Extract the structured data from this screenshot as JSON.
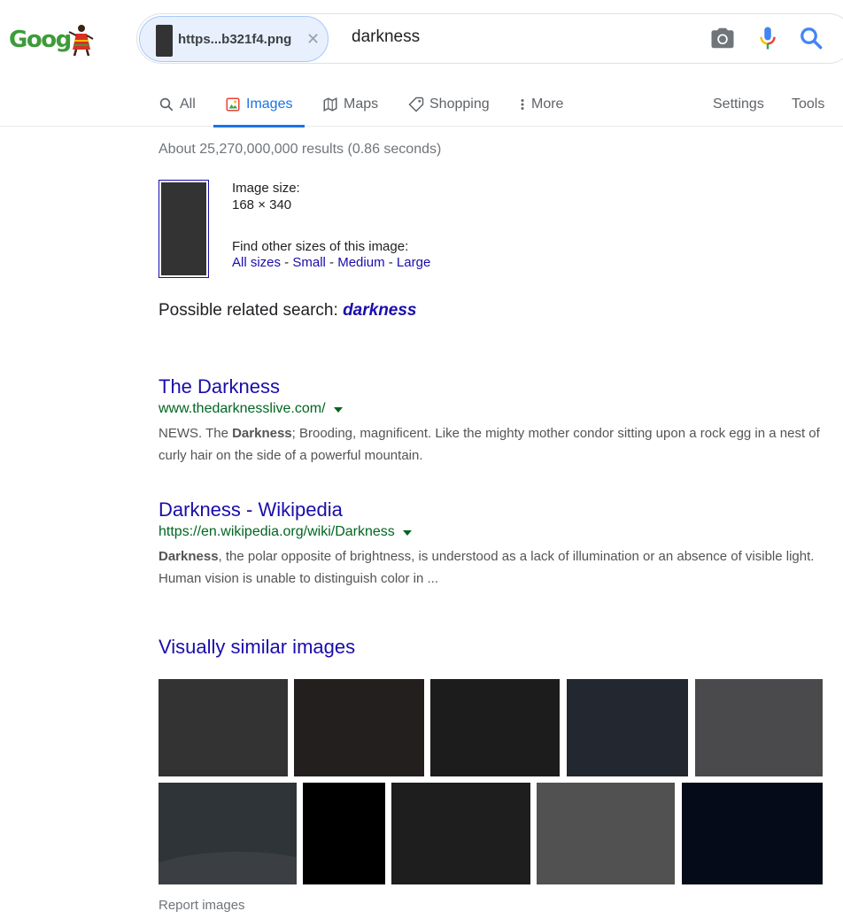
{
  "logo_text": "Goog",
  "search": {
    "chip_label": "https...b321f4.png",
    "query": "darkness"
  },
  "tabs": [
    {
      "label": "All",
      "icon": "search-icon"
    },
    {
      "label": "Images",
      "icon": "image-icon",
      "active": true
    },
    {
      "label": "Maps",
      "icon": "map-icon"
    },
    {
      "label": "Shopping",
      "icon": "tag-icon"
    },
    {
      "label": "More",
      "icon": "more-vert-icon"
    },
    {
      "label": "Settings"
    },
    {
      "label": "Tools"
    }
  ],
  "stats": "About 25,270,000,000 results (0.86 seconds)",
  "image_info": {
    "size_label": "Image size:",
    "size_value": "168 × 340",
    "other_sizes_label": "Find other sizes of this image:",
    "sizes": [
      "All sizes",
      "Small",
      "Medium",
      "Large"
    ]
  },
  "related": {
    "label": "Possible related search:",
    "term": "darkness"
  },
  "results": [
    {
      "title": "The Darkness",
      "url": "www.thedarknesslive.com/",
      "snippet_pre": "NEWS. The ",
      "snippet_bold": "Darkness",
      "snippet_post": "; Brooding, magnificent. Like the mighty mother condor sitting upon a rock egg in a nest of curly hair on the side of a powerful mountain."
    },
    {
      "title": "Darkness - Wikipedia",
      "url": "https://en.wikipedia.org/wiki/Darkness",
      "snippet_pre": "",
      "snippet_bold": "Darkness",
      "snippet_post": ", the polar opposite of brightness, is understood as a lack of illumination or an absence of visible light. Human vision is unable to distinguish color in ..."
    }
  ],
  "similar": {
    "heading": "Visually similar images",
    "tile_colors": [
      "#333333",
      "#231f1e",
      "#1c1c1c",
      "#222730",
      "#4a494b",
      "#2f3438",
      "#000000",
      "#1e1e1e",
      "#515151",
      "#050b18"
    ]
  },
  "report": "Report images",
  "colors": {
    "link": "#1a0dab",
    "url_green": "#006621",
    "accent": "#1a73e8"
  }
}
